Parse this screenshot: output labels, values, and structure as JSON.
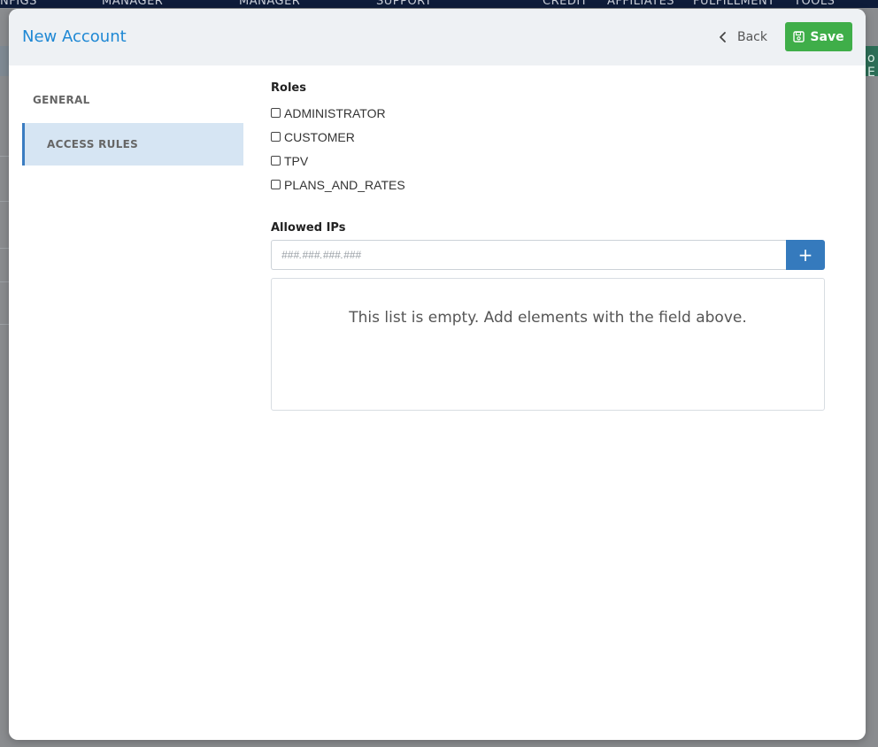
{
  "background": {
    "nav_items": [
      "NFIGS",
      "MANAGER",
      "MANAGER",
      "SUPPORT",
      "CREDIT",
      "AFFILIATES",
      "FULFILLMENT",
      "TOOLS"
    ],
    "left_fragment": "o",
    "right_fragment": "o E"
  },
  "modal": {
    "title": "New Account",
    "back_label": "Back",
    "save_label": "Save"
  },
  "sidenav": {
    "items": [
      {
        "label": "GENERAL",
        "active": false
      },
      {
        "label": "ACCESS RULES",
        "active": true
      }
    ]
  },
  "roles": {
    "label": "Roles",
    "options": [
      {
        "label": "ADMINISTRATOR",
        "checked": false
      },
      {
        "label": "CUSTOMER",
        "checked": false
      },
      {
        "label": "TPV",
        "checked": false
      },
      {
        "label": "PLANS_AND_RATES",
        "checked": false
      }
    ]
  },
  "allowed_ips": {
    "label": "Allowed IPs",
    "placeholder": "###.###.###.###",
    "value": "",
    "add_label": "+",
    "empty_message": "This list is empty. Add elements with the field above."
  },
  "colors": {
    "accent": "#1e88d4",
    "save": "#3fae49",
    "add": "#357abd",
    "active_nav": "#d6e5f3"
  }
}
